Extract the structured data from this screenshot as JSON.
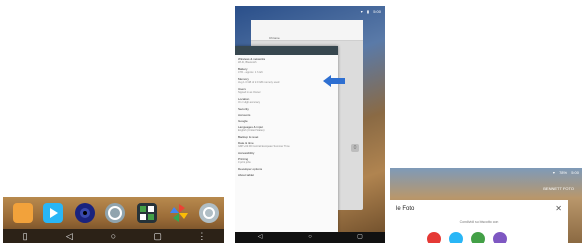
{
  "colors": {
    "dock_bg": "#a57540",
    "nav_bar": "#2c2217",
    "settings_header": "#37474f",
    "arrow": "#2e6fd1"
  },
  "panel1": {
    "apps": [
      {
        "icon": "home-launcher-icon",
        "color": "#f2a23b"
      },
      {
        "icon": "play-store-icon",
        "color": "#29b6f6"
      },
      {
        "icon": "speaker-icon",
        "color": "#1a237e"
      },
      {
        "icon": "settings-gear-icon",
        "color": "#90a4ae"
      },
      {
        "icon": "calculator-icon",
        "color": "#43a047"
      },
      {
        "icon": "photos-pinwheel-icon",
        "color": "#fbbc05"
      },
      {
        "icon": "app-drawer-icon",
        "color": "#b0bec5"
      }
    ],
    "nav": {
      "apps": "▯",
      "back": "◁",
      "home": "○",
      "recents": "▢",
      "menu": "⋮"
    }
  },
  "panel2": {
    "status": {
      "wifi": "▾",
      "battery": "▮",
      "time": "5:00"
    },
    "back_card": {
      "app_name": "Chrome",
      "side_badge": "0"
    },
    "settings_rows": [
      {
        "title": "Wireless & networks",
        "sub": "Wi-Fi, Bluetooth"
      },
      {
        "title": "Battery",
        "sub": "47% - approx. 1 h left"
      },
      {
        "title": "Memory",
        "sub": "Avg 1.3 GB of 2.0 GB memory used"
      },
      {
        "title": "Users",
        "sub": "Signed in as Owner"
      },
      {
        "title": "Location",
        "sub": "On / High accuracy"
      },
      {
        "title": "Security",
        "sub": ""
      },
      {
        "title": "Accounts",
        "sub": ""
      },
      {
        "title": "Google",
        "sub": ""
      },
      {
        "title": "Languages & input",
        "sub": "English (United States)"
      },
      {
        "title": "Backup & reset",
        "sub": ""
      },
      {
        "title": "Date & time",
        "sub": "GMT+02:00 Central European Summer Time"
      },
      {
        "title": "Accessibility",
        "sub": ""
      },
      {
        "title": "Printing",
        "sub": "0 print jobs"
      },
      {
        "title": "Developer options",
        "sub": ""
      },
      {
        "title": "About tablet",
        "sub": ""
      }
    ],
    "nav": {
      "back": "◁",
      "home": "○",
      "recents": "▢"
    }
  },
  "panel3": {
    "status": {
      "wifi": "▾",
      "battery": "78%",
      "time": "5:00"
    },
    "toolbar_label": "BENNETT FOTO",
    "dialog": {
      "title": "le Foto",
      "subtitle": "Condividi su biscotto con",
      "close": "✕"
    },
    "share_targets": [
      {
        "icon": "share-red-icon",
        "color": "#e53935"
      },
      {
        "icon": "share-blue-icon",
        "color": "#29b6f6"
      },
      {
        "icon": "share-green-icon",
        "color": "#43a047"
      },
      {
        "icon": "share-purple-icon",
        "color": "#7e57c2"
      }
    ]
  }
}
